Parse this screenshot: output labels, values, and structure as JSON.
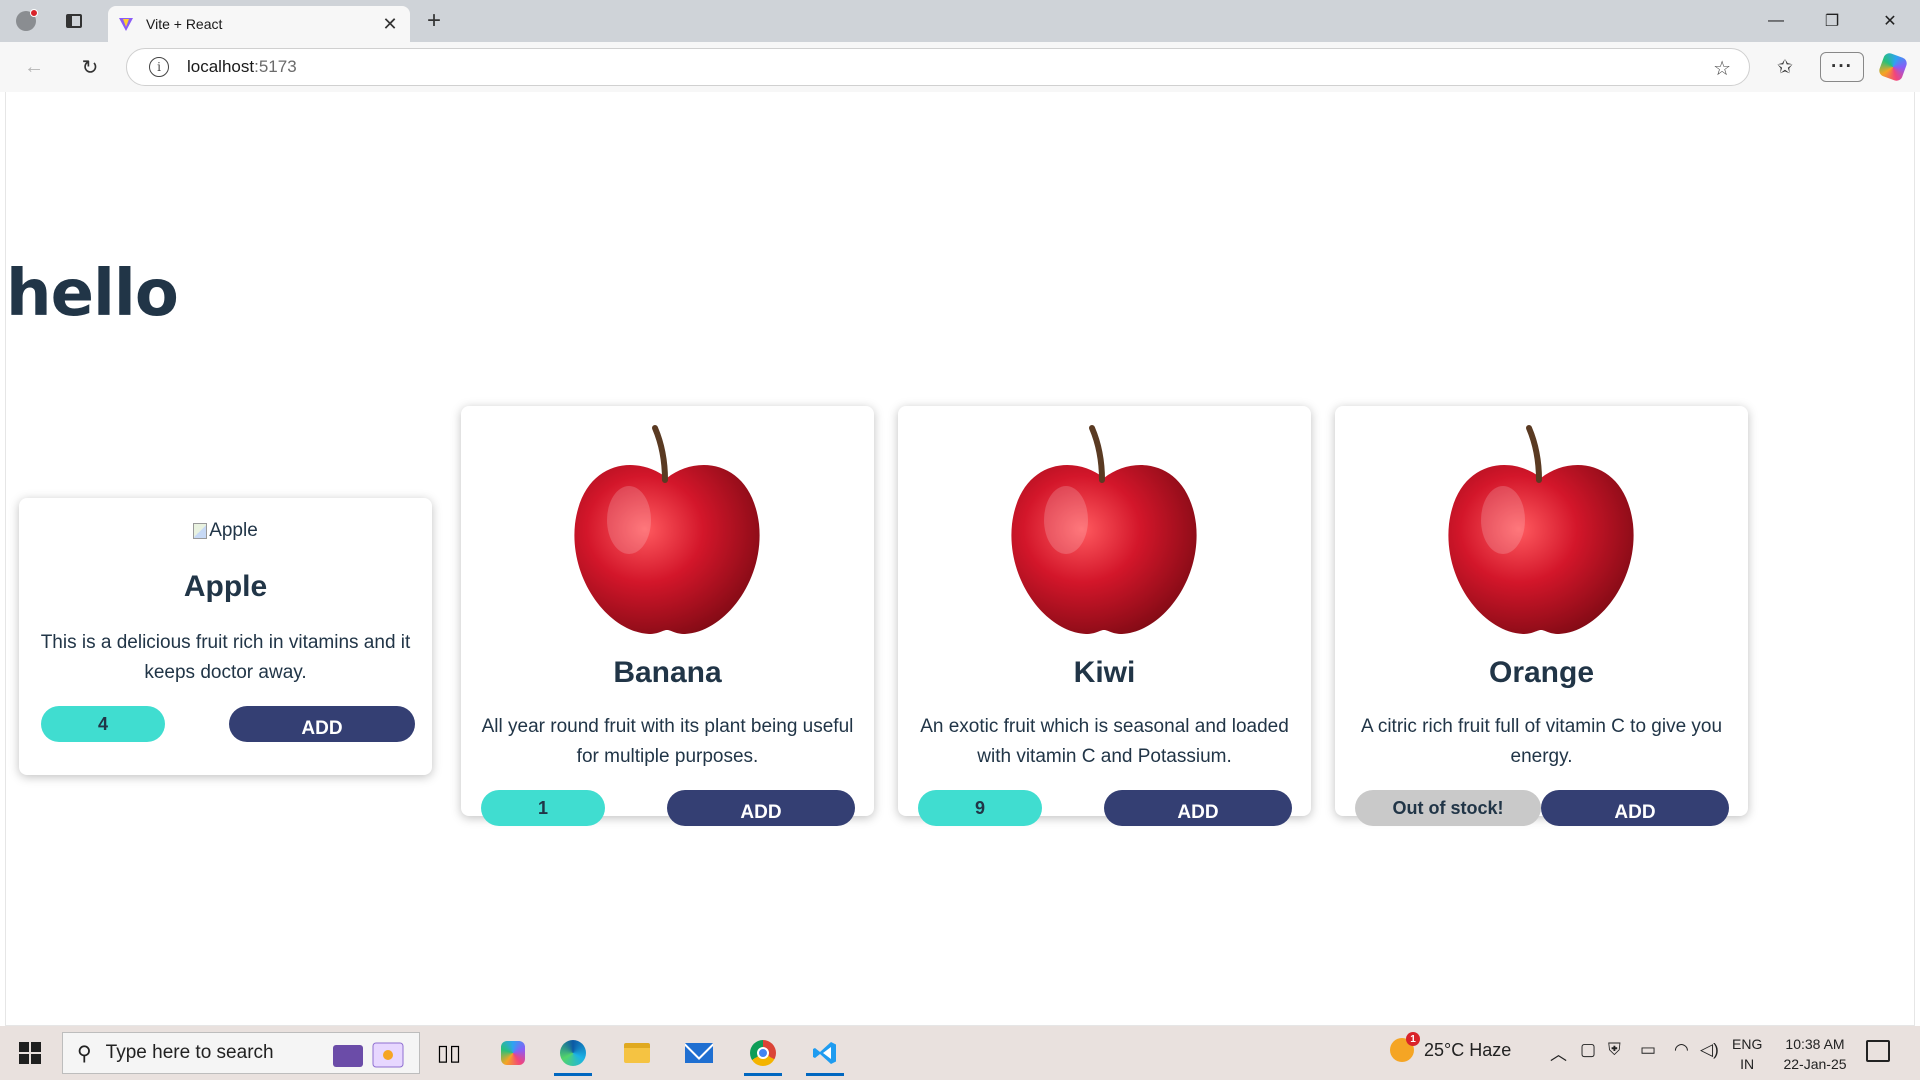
{
  "browser": {
    "tab_title": "Vite + React",
    "url_host": "localhost",
    "url_port": ":5173",
    "accent": "#0067c0"
  },
  "page": {
    "heading": "hello",
    "text_color": "#213547",
    "count_color": "#40ddd0",
    "button_color": "#343f73",
    "cards": [
      {
        "name": "Apple",
        "image_alt": "Apple",
        "image_broken": true,
        "description": "This is a delicious fruit rich in vitamins and it keeps doctor away.",
        "stock_label": "4",
        "add_label": "ADD"
      },
      {
        "name": "Banana",
        "image_alt": "Banana",
        "image_icon": "red-apple-photo",
        "description": "All year round fruit with its plant being useful for multiple purposes.",
        "stock_label": "1",
        "add_label": "ADD"
      },
      {
        "name": "Kiwi",
        "image_alt": "Kiwi",
        "image_icon": "red-apple-photo",
        "description": "An exotic fruit which is seasonal and loaded with vitamin C and Potassium.",
        "stock_label": "9",
        "add_label": "ADD"
      },
      {
        "name": "Orange",
        "image_alt": "Orange",
        "image_icon": "red-apple-photo",
        "description": "A citric rich fruit full of vitamin C to give you energy.",
        "stock_label": "Out of stock!",
        "add_label": "ADD"
      }
    ]
  },
  "taskbar": {
    "search_placeholder": "Type here to search",
    "weather": "25°C  Haze",
    "weather_badge": "1",
    "lang_line1": "ENG",
    "lang_line2": "IN",
    "time": "10:38 AM",
    "date": "22-Jan-25"
  }
}
